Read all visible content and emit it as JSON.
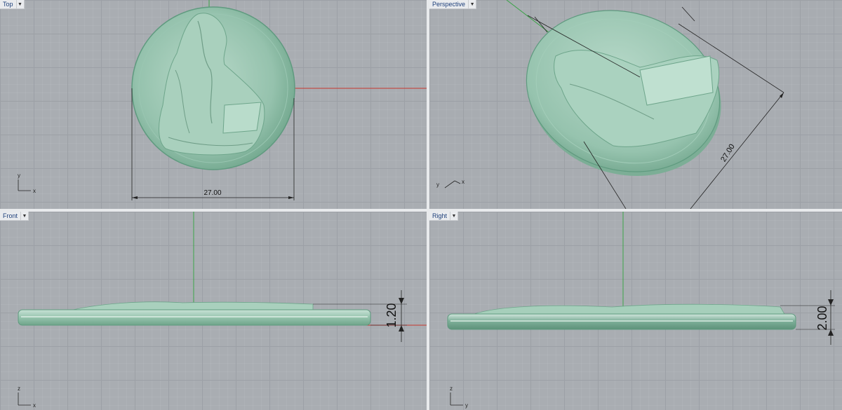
{
  "viewports": {
    "top": {
      "title": "Top",
      "menu_icon": "dropdown-arrow"
    },
    "perspective": {
      "title": "Perspective",
      "menu_icon": "dropdown-arrow"
    },
    "front": {
      "title": "Front",
      "menu_icon": "dropdown-arrow"
    },
    "right": {
      "title": "Right",
      "menu_icon": "dropdown-arrow"
    }
  },
  "dimensions": {
    "top_diameter": "27.00",
    "perspective_diameter": "27.00",
    "front_thickness": "1.20",
    "right_thickness": "2.00"
  },
  "axes": {
    "top": {
      "vertical": "y",
      "horizontal": "x"
    },
    "perspective": {
      "a": "y",
      "b": "x"
    },
    "front": {
      "vertical": "z",
      "horizontal": "x"
    },
    "right": {
      "vertical": "z",
      "horizontal": "y"
    }
  },
  "colors": {
    "model": "#8fbfa9",
    "model_edge": "#5f9a7f",
    "x_axis": "#c8362e",
    "y_axis": "#3aa347",
    "grid": "#a9adb2"
  }
}
